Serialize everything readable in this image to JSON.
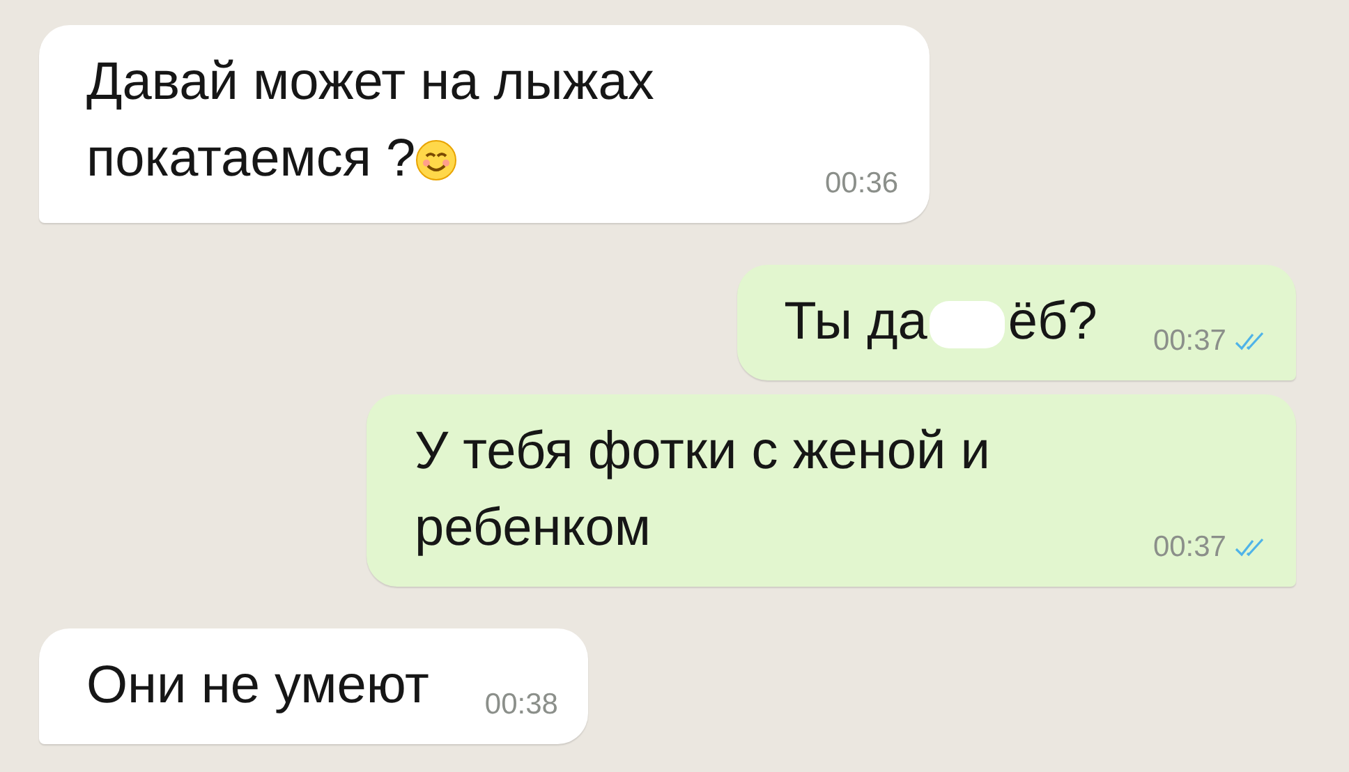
{
  "messages": [
    {
      "kind": "incoming",
      "segments": [
        "Давай может на лыжах покатаемся ?"
      ],
      "emoji": true,
      "time": "00:36"
    },
    {
      "kind": "outgoing",
      "segments": [
        "Ты да",
        "ёб?"
      ],
      "emoji": false,
      "time": "00:37",
      "read": true
    },
    {
      "kind": "outgoing",
      "segments": [
        "У тебя фотки с женой и ребенком"
      ],
      "emoji": false,
      "time": "00:37",
      "read": true
    },
    {
      "kind": "incoming",
      "segments": [
        "Они не умеют"
      ],
      "emoji": false,
      "time": "00:38"
    }
  ]
}
